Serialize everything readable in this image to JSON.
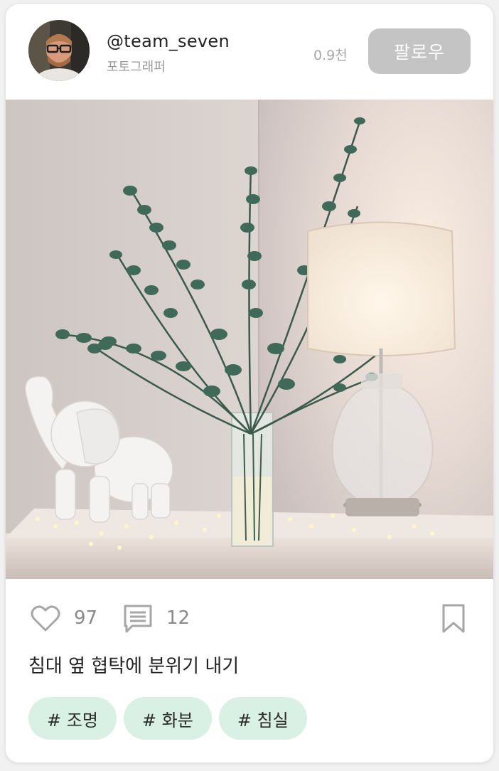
{
  "profile": {
    "username": "@team_seven",
    "role": "포토그래퍼",
    "followers": "0.9천",
    "follow_label": "팔로우"
  },
  "post": {
    "likes": "97",
    "comments": "12",
    "caption": "침대 옆 협탁에 분위기 내기",
    "tags": [
      "# 조명",
      "# 화분",
      "# 침실"
    ]
  },
  "colors": {
    "follow_button": "#c4c4c4",
    "tag_bg": "#d9f0e4",
    "icon": "#9a9a9a"
  },
  "icons": [
    "heart-icon",
    "comment-icon",
    "bookmark-icon"
  ]
}
